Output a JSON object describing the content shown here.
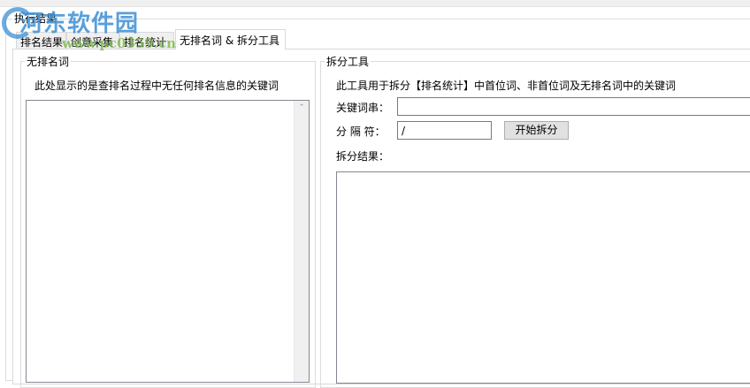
{
  "window": {
    "group_title": "执行结果"
  },
  "tabs": [
    {
      "label": "排名结果",
      "active": false
    },
    {
      "label": "创意采集",
      "active": false
    },
    {
      "label": "排名统计",
      "active": false
    },
    {
      "label": "无排名词 & 拆分工具",
      "active": true
    }
  ],
  "left_group": {
    "title": "无排名词",
    "description": "此处显示的是查排名过程中无任何排名信息的关键词",
    "scroll_up_icon": "chevron-up-icon"
  },
  "right_group": {
    "title": "拆分工具",
    "description": "此工具用于拆分【排名统计】中首位词、非首位词及无排名词中的关键词",
    "keyword_label": "关键词串：",
    "keyword_value": "",
    "separator_label": "分 隔 符：",
    "separator_value": "/",
    "split_button": "开始拆分",
    "result_label": "拆分结果："
  },
  "watermark": {
    "name": "河东软件园",
    "url": "www.pc0359.cn"
  }
}
